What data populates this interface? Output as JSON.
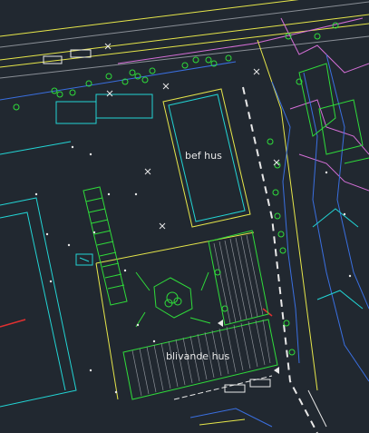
{
  "drawing": {
    "labels": {
      "existing_house": "bef hus",
      "planned_house": "blivande hus"
    },
    "colors": {
      "background": "#212830",
      "cyan": "#22d4d4",
      "yellow": "#e6e64a",
      "green": "#2fdc3a",
      "white": "#e8e8e8",
      "magenta": "#d46fd6",
      "blue": "#3a6fe0",
      "red": "#e03030",
      "gray": "#8a8f96"
    }
  }
}
